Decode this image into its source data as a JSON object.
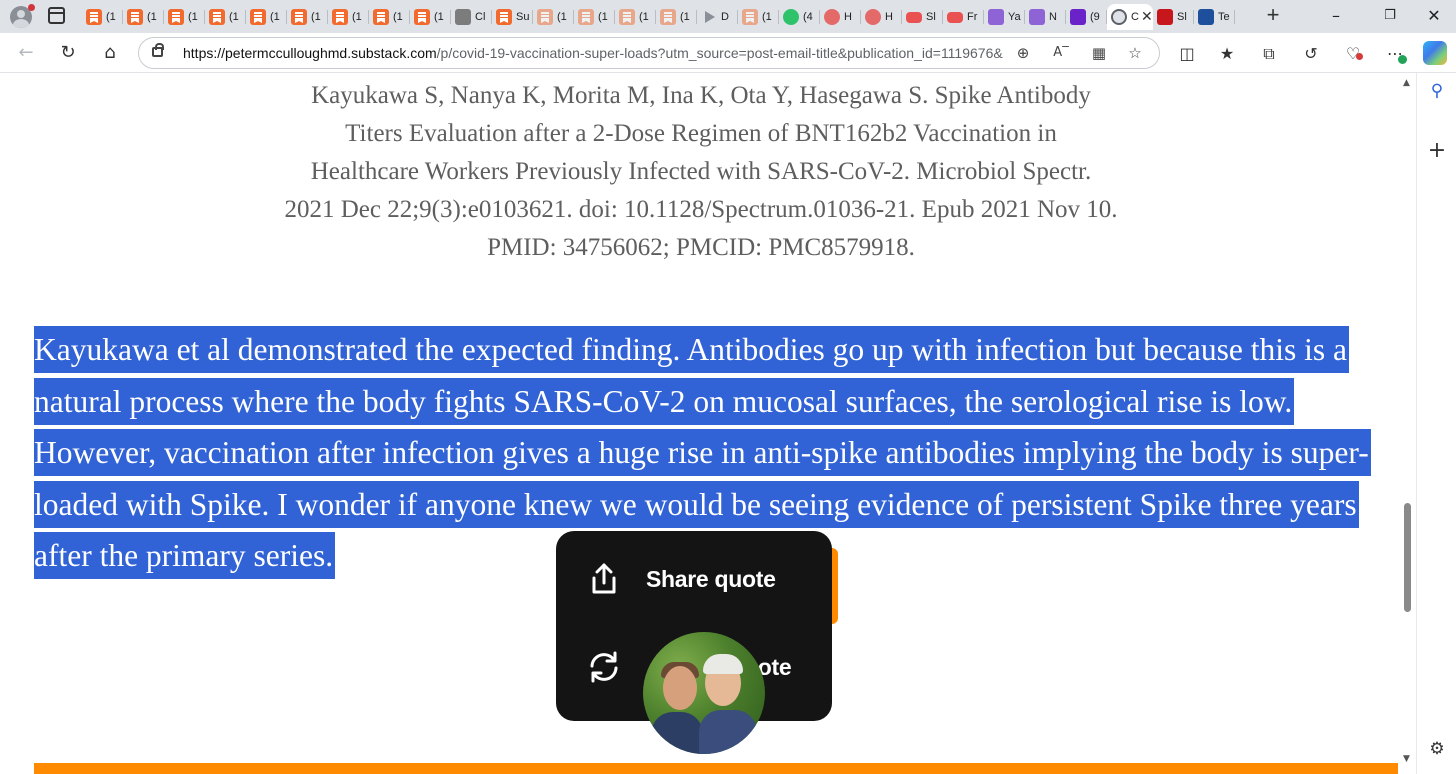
{
  "browser": {
    "tabs": [
      {
        "label": "(1",
        "favicon": "substack-icon"
      },
      {
        "label": "(1",
        "favicon": "substack-icon"
      },
      {
        "label": "(1",
        "favicon": "substack-icon"
      },
      {
        "label": "(1",
        "favicon": "substack-icon"
      },
      {
        "label": "(1",
        "favicon": "substack-icon"
      },
      {
        "label": "(1",
        "favicon": "substack-icon"
      },
      {
        "label": "(1",
        "favicon": "substack-icon"
      },
      {
        "label": "(1",
        "favicon": "substack-icon"
      },
      {
        "label": "(1",
        "favicon": "substack-icon"
      },
      {
        "label": "Cl",
        "favicon": "gray-i-icon"
      },
      {
        "label": "Su",
        "favicon": "substack-icon"
      },
      {
        "label": "(1",
        "favicon": "substack-faded-icon"
      },
      {
        "label": "(1",
        "favicon": "substack-faded-icon"
      },
      {
        "label": "(1",
        "favicon": "substack-faded-icon"
      },
      {
        "label": "(1",
        "favicon": "substack-faded-icon"
      },
      {
        "label": "D",
        "favicon": "play-icon"
      },
      {
        "label": "(1",
        "favicon": "substack-faded-icon"
      },
      {
        "label": "(4",
        "favicon": "green-g-icon"
      },
      {
        "label": "H",
        "favicon": "pink-icon"
      },
      {
        "label": "H",
        "favicon": "pink-icon"
      },
      {
        "label": "Sl",
        "favicon": "youtube-icon"
      },
      {
        "label": "Fr",
        "favicon": "youtube-icon"
      },
      {
        "label": "Ya",
        "favicon": "yahoo-icon"
      },
      {
        "label": "N",
        "favicon": "yahoo-icon"
      },
      {
        "label": "(9",
        "favicon": "mail-icon"
      },
      {
        "label": "C",
        "favicon": "active-c-icon",
        "active": true
      },
      {
        "label": "Sl",
        "favicon": "pdf-icon"
      },
      {
        "label": "Te",
        "favicon": "m-icon"
      }
    ],
    "url_domain": "https://petermcculloughmd.substack.com",
    "url_path": "/p/covid-19-vaccination-super-loads?utm_source=post-email-title&publication_id=1119676&p...",
    "colors": {
      "selection": "#3163d6",
      "accent": "#ff8a00",
      "popup_bg": "#141414"
    }
  },
  "article": {
    "citation_lines": [
      "Kayukawa S, Nanya K, Morita M, Ina K, Ota Y, Hasegawa S. Spike Antibody",
      "Titers Evaluation after a 2-Dose Regimen of BNT162b2 Vaccination in",
      "Healthcare Workers Previously Infected with SARS-CoV-2. Microbiol Spectr.",
      "2021 Dec 22;9(3):e0103621. doi: 10.1128/Spectrum.01036-21. Epub 2021 Nov 10.",
      "PMID: 34756062; PMCID: PMC8579918."
    ],
    "selected_paragraph": "Kayukawa et al demonstrated the expected finding. Antibodies go up with infection but because this is a natural process where the body fights SARS-CoV-2 on mucosal surfaces, the serological rise is low. However, vaccination after infection gives a huge rise in anti-spike antibodies implying the body is super-loaded with Spike. I wonder if anyone knew we would be seeing evidence of persistent Spike three years after the primary series."
  },
  "popup": {
    "share_label": "Share quote",
    "restack_label": "uote"
  }
}
